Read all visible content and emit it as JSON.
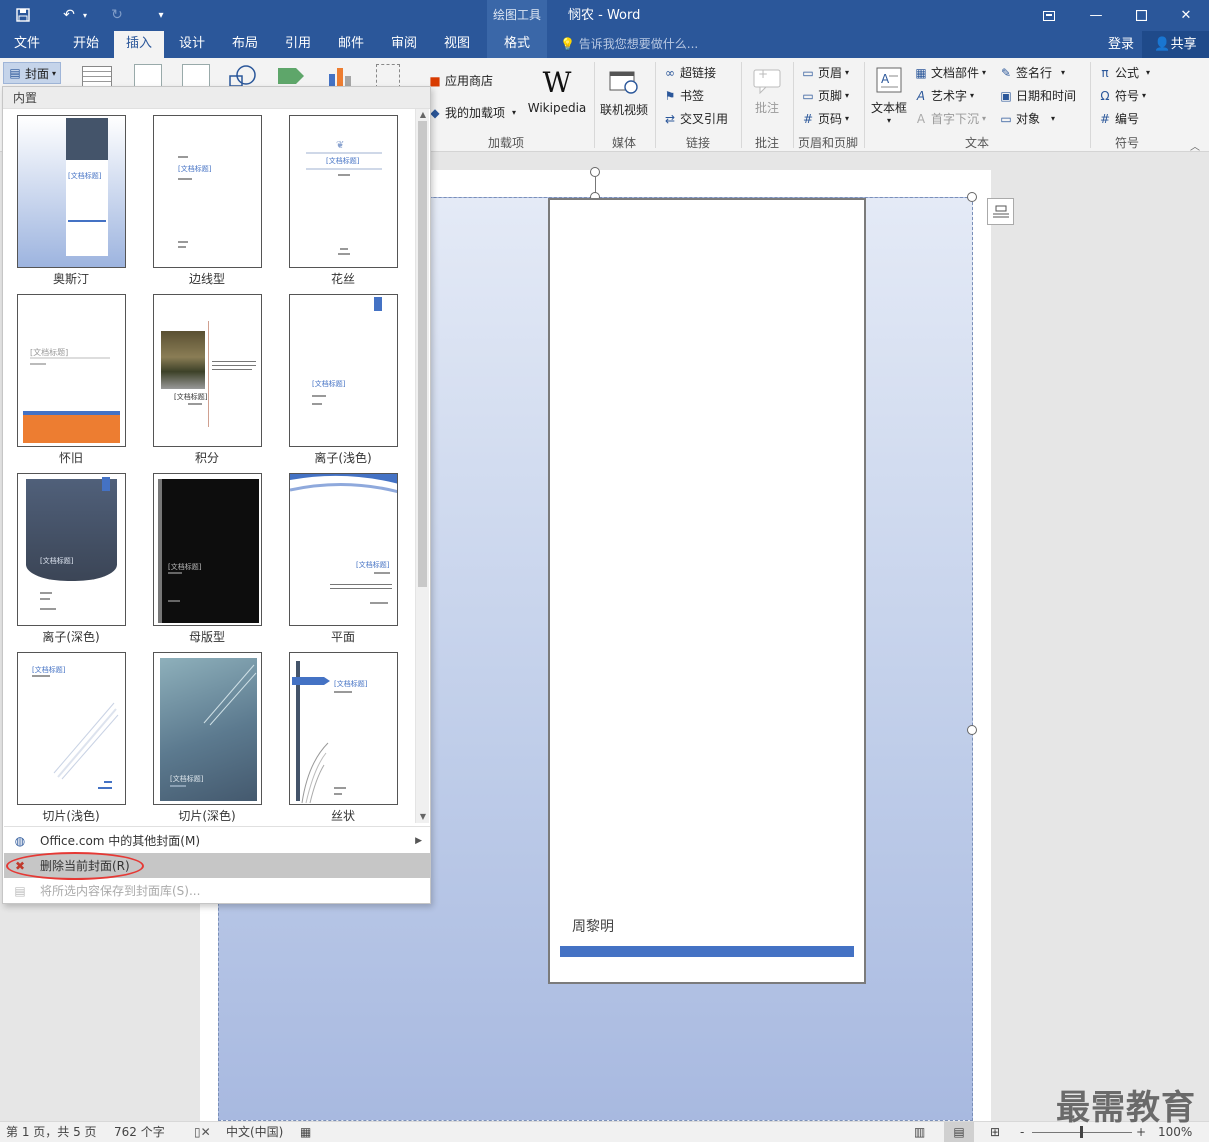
{
  "titlebar": {
    "doc_title": "悯农 - Word",
    "context_tool": "绘图工具",
    "icons": [
      "save-icon",
      "undo-icon",
      "redo-icon",
      "customize-qat-icon",
      "ribbon-display-icon",
      "minimize-icon",
      "maximize-icon",
      "close-icon"
    ]
  },
  "tabs": {
    "file": "文件",
    "home": "开始",
    "insert": "插入",
    "design": "设计",
    "layout": "布局",
    "references": "引用",
    "mailings": "邮件",
    "review": "审阅",
    "view": "视图",
    "format": "格式",
    "tellme": "告诉我您想要做什么...",
    "login": "登录",
    "share": "共享"
  },
  "ribbon": {
    "cover_button": "封面",
    "store": "应用商店",
    "my_addins": "我的加载项",
    "wikipedia": "Wikipedia",
    "online_video": "联机视频",
    "hyperlink": "超链接",
    "bookmark": "书签",
    "cross_reference": "交叉引用",
    "comment": "批注",
    "header": "页眉",
    "footer": "页脚",
    "page_number": "页码",
    "textbox": "文本框",
    "quick_parts": "文档部件",
    "wordart": "艺术字",
    "dropcap": "首字下沉",
    "signature_line": "签名行",
    "date_time": "日期和时间",
    "object": "对象",
    "equation": "公式",
    "symbol": "符号",
    "number": "编号",
    "groups": {
      "addins": "加载项",
      "media": "媒体",
      "links": "链接",
      "comments": "批注",
      "header_footer": "页眉和页脚",
      "text": "文本",
      "symbols": "符号"
    }
  },
  "gallery": {
    "header": "内置",
    "tiles": [
      {
        "name": "奥斯汀",
        "title": "[文档标题]"
      },
      {
        "name": "边线型",
        "title": "[文档标题]"
      },
      {
        "name": "花丝",
        "title": "[文档标题]"
      },
      {
        "name": "怀旧",
        "title": "[文档标题]"
      },
      {
        "name": "积分",
        "title": "[文档标题]"
      },
      {
        "name": "离子(浅色)",
        "title": "[文档标题]"
      },
      {
        "name": "离子(深色)",
        "title": "[文档标题]"
      },
      {
        "name": "母版型",
        "title": "[文档标题]"
      },
      {
        "name": "平面",
        "title": "[文档标题]"
      },
      {
        "name": "切片(浅色)",
        "title": "[文档标题]"
      },
      {
        "name": "切片(深色)",
        "title": "[文档标题]"
      },
      {
        "name": "丝状",
        "title": "[文档标题]"
      }
    ],
    "menu": {
      "more_office": "Office.com 中的其他封面(M)",
      "remove_cover": "删除当前封面(R)",
      "save_selection": "将所选内容保存到封面库(S)..."
    }
  },
  "document": {
    "author": "周黎明"
  },
  "statusbar": {
    "page": "第 1 页，共 5 页",
    "words": "762 个字",
    "language": "中文(中国)",
    "zoom": "100%",
    "zoom_minus": "-",
    "zoom_plus": "+"
  },
  "watermark": "最需教育",
  "colors": {
    "brand": "#2b579a",
    "highlight_ring": "#e53935",
    "cover_accent": "#4472c4",
    "orange": "#ed7d31"
  }
}
